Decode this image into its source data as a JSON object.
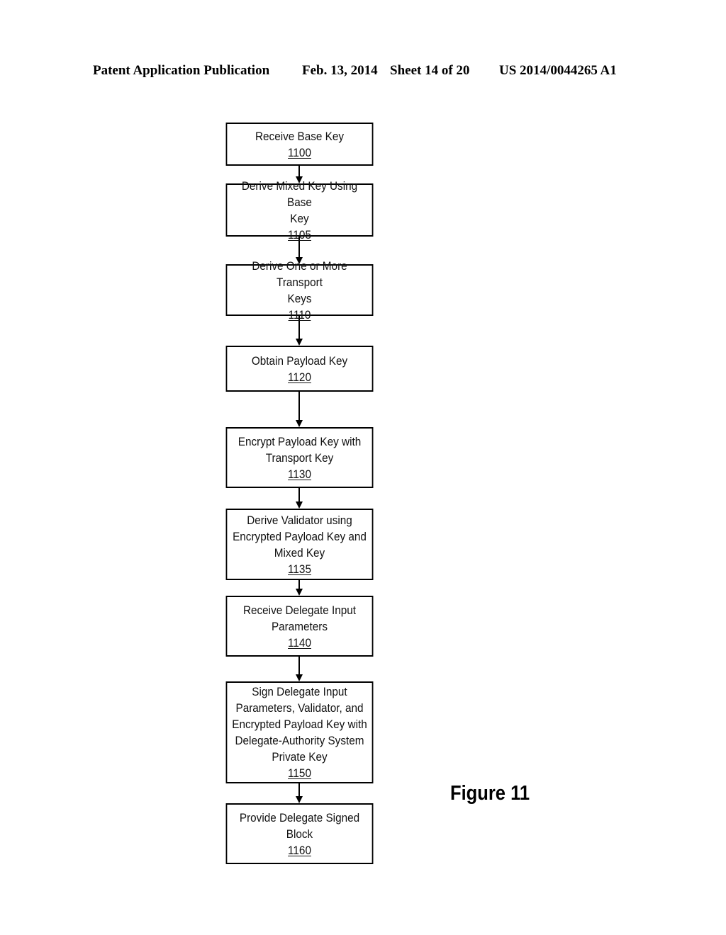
{
  "header": {
    "publication": "Patent Application Publication",
    "date": "Feb. 13, 2014",
    "sheet": "Sheet 14 of 20",
    "number": "US 2014/0044265 A1"
  },
  "figure_label": "Figure 11",
  "steps": [
    {
      "label": "Receive Base Key",
      "ref": "1100"
    },
    {
      "label": "Derive Mixed Key Using Base\nKey",
      "ref": "1105"
    },
    {
      "label": "Derive One or More Transport\nKeys",
      "ref": "1110"
    },
    {
      "label": "Obtain Payload Key",
      "ref": "1120"
    },
    {
      "label": "Encrypt Payload Key with\nTransport Key",
      "ref": "1130"
    },
    {
      "label": "Derive Validator using\nEncrypted Payload Key and\nMixed Key",
      "ref": "1135"
    },
    {
      "label": "Receive Delegate Input\nParameters",
      "ref": "1140"
    },
    {
      "label": "Sign Delegate Input\nParameters, Validator, and\nEncrypted Payload Key with\nDelegate-Authority System\nPrivate Key",
      "ref": "1150"
    },
    {
      "label": "Provide Delegate Signed Block",
      "ref": "1160"
    }
  ],
  "edges": [
    {
      "from": "1100",
      "to": "1105"
    },
    {
      "from": "1105",
      "to": "1110"
    },
    {
      "from": "1110",
      "to": "1120"
    },
    {
      "from": "1120",
      "to": "1130"
    },
    {
      "from": "1130",
      "to": "1135"
    },
    {
      "from": "1135",
      "to": "1140"
    },
    {
      "from": "1140",
      "to": "1150"
    },
    {
      "from": "1150",
      "to": "1160"
    }
  ]
}
